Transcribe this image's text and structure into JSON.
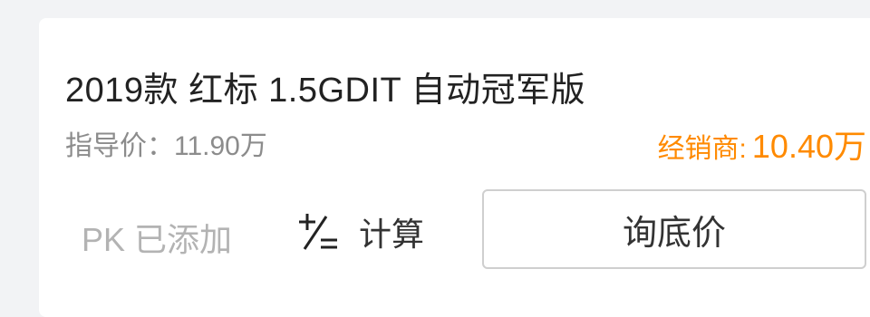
{
  "car": {
    "title": "2019款 红标 1.5GDIT 自动冠军版",
    "guide_price_text": "指导价：11.90万",
    "dealer_label": "经销商:",
    "dealer_price": "10.40万"
  },
  "actions": {
    "pk_label": "PK 已添加",
    "calc_icon": "calculator-icon",
    "calc_label": "计算",
    "inquiry_label": "询底价"
  },
  "colors": {
    "accent_orange": "#ff8a00",
    "text_dark": "#222222",
    "text_gray": "#8c8c8c",
    "text_light": "#b3b3b3",
    "border": "#cfcfcf",
    "background": "#f2f3f5"
  }
}
